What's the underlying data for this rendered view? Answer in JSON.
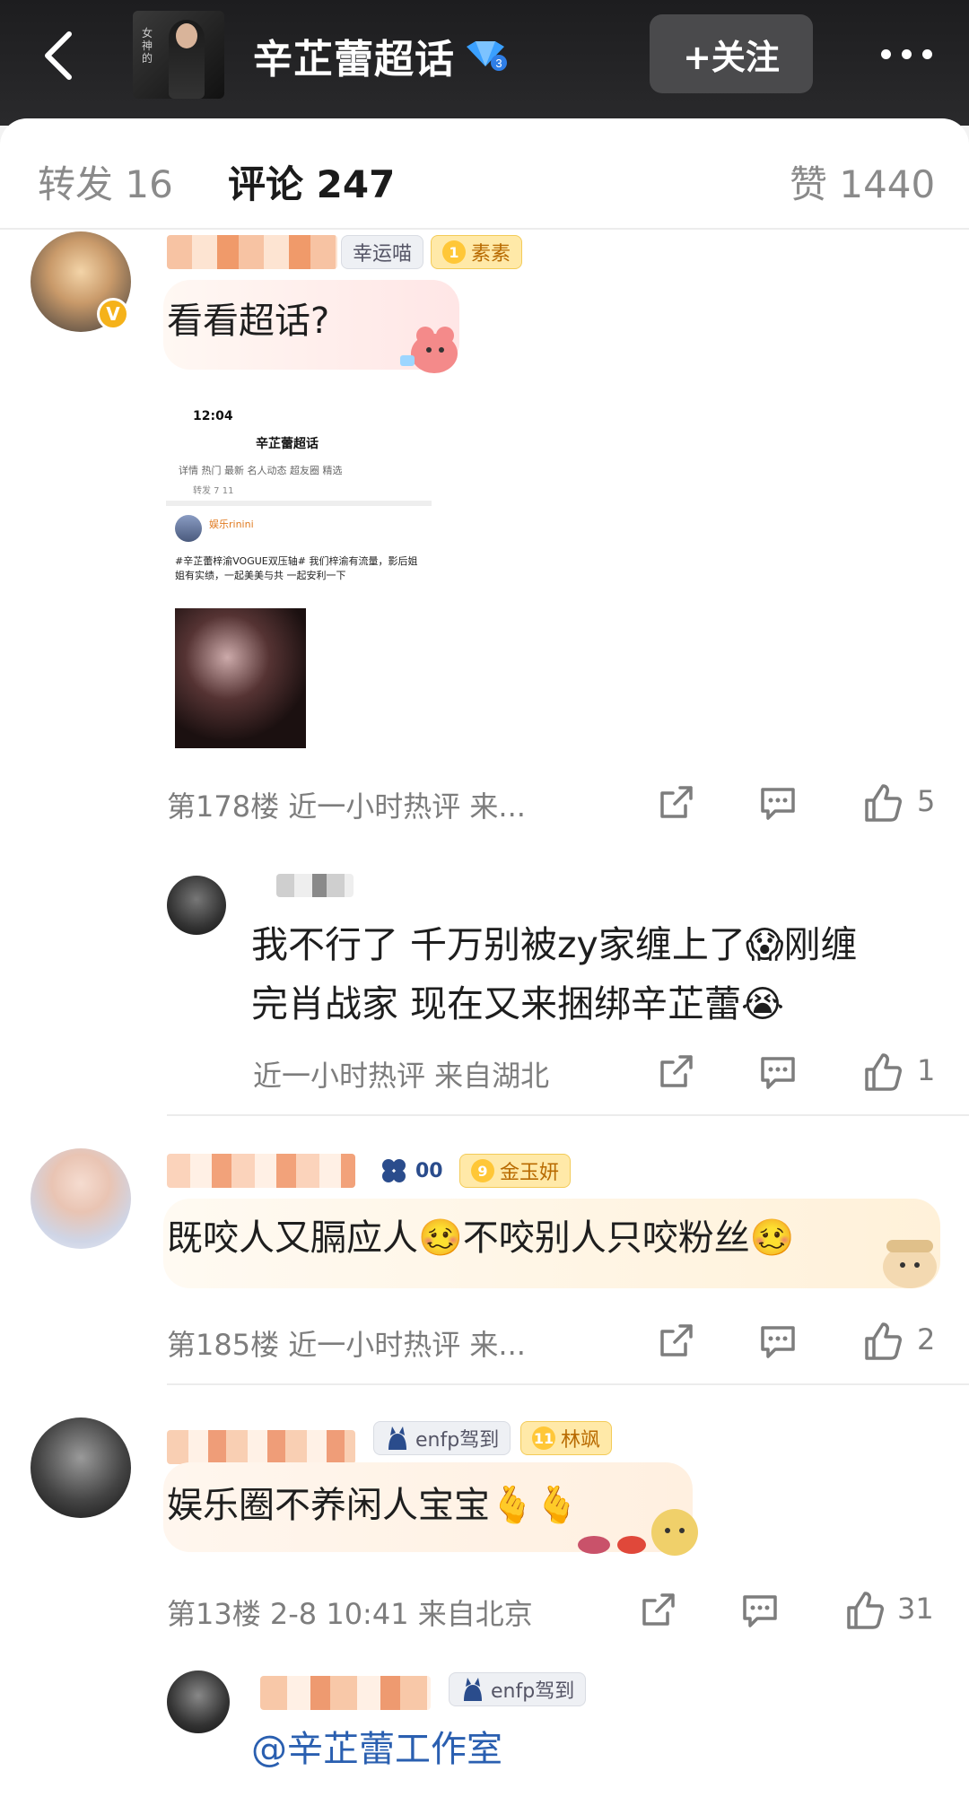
{
  "header": {
    "title": "辛芷蕾超话",
    "follow_label": "+关注",
    "thumb_text": "女神的"
  },
  "tabs": {
    "repost": "转发 16",
    "comments": "评论 247",
    "likes": "赞 1440"
  },
  "comments": [
    {
      "user_tag": "幸运喵",
      "fan_badge": "素素",
      "fan_level": "1",
      "text": "看看超话?",
      "embed": {
        "status_time": "12:04",
        "title": "辛芷蕾超话",
        "tabs": "详情  热门  最新  名人动态  超友圈  精选",
        "sub": "转发        7        11",
        "user": "娱乐rinini",
        "body": "#辛芷蕾梓渝VOGUE双压轴# 我们梓渝有流量，影后姐姐有实绩，一起美美与共 一起安利一下"
      },
      "meta": "第178楼 近一小时热评 来...",
      "likes": "5"
    },
    {
      "text_line1": "我不行了 千万别被zy家缠上了😱刚缠",
      "text_line2": "完肖战家 现在又来捆绑辛芷蕾😭",
      "meta": "近一小时热评 来自湖北",
      "likes": "1"
    },
    {
      "user_tag": "00",
      "fan_badge": "金玉妍",
      "fan_level": "9",
      "text": "既咬人又膈应人🥴不咬别人只咬粉丝🥴",
      "meta": "第185楼 近一小时热评 来...",
      "likes": "2"
    },
    {
      "user_tag": "enfp驾到",
      "fan_badge": "林飒",
      "fan_level": "11",
      "text": "娱乐圈不养闲人宝宝🫰🫰",
      "meta": "第13楼 2-8 10:41 来自北京",
      "likes": "31"
    },
    {
      "user_tag": "enfp驾到",
      "text": "@辛芷蕾工作室"
    }
  ]
}
